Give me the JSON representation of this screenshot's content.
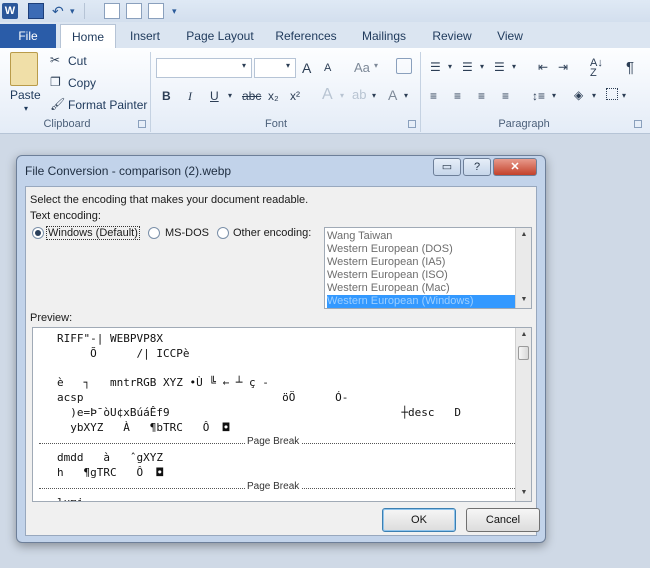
{
  "qat": {
    "logo": "W"
  },
  "tabs": [
    {
      "label": "File"
    },
    {
      "label": "Home"
    },
    {
      "label": "Insert"
    },
    {
      "label": "Page Layout"
    },
    {
      "label": "References"
    },
    {
      "label": "Mailings"
    },
    {
      "label": "Review"
    },
    {
      "label": "View"
    }
  ],
  "ribbon": {
    "clipboard": {
      "paste": "Paste",
      "cut": "Cut",
      "copy": "Copy",
      "format_painter": "Format Painter",
      "label": "Clipboard"
    },
    "font": {
      "label": "Font",
      "bold": "B",
      "italic": "I",
      "underline": "U",
      "strike": "abc",
      "sub": "x₂",
      "sup": "x²",
      "grow": "A",
      "shrink": "A",
      "change_case": "Aa"
    },
    "paragraph": {
      "label": "Paragraph",
      "pilcrow": "¶"
    }
  },
  "dialog": {
    "title": "File Conversion - comparison (2).webp",
    "instruction": "Select the encoding that makes your document readable.",
    "text_encoding_label": "Text encoding:",
    "options": [
      {
        "label": "Windows (Default)",
        "selected": true
      },
      {
        "label": "MS-DOS",
        "selected": false
      },
      {
        "label": "Other encoding:",
        "selected": false
      }
    ],
    "encodings": [
      "Wang Taiwan",
      "Western European (DOS)",
      "Western European (IA5)",
      "Western European (ISO)",
      "Western European (Mac)",
      "Western European (Windows)"
    ],
    "selected_encoding": "Western European (Windows)",
    "preview_label": "Preview:",
    "preview_lines": [
      "RIFF\"-| WEBPVP8X",
      "     Õ      /| ICCPè",
      "",
      "è   ┐   mntrRGB XYZ •Ù ╚ ← ┴ ç -",
      "acsp                              öÖ      Ó-",
      "  )e=Þ¯òU¢xBúáÊf9                                   ┼desc   D",
      "  ybXYZ   À   ¶bTRC   Ô  ◘"
    ],
    "page_break": "Page Break",
    "preview_lines_2": [
      "dmdd   à   ˆgXYZ",
      "h   ¶gTRC   Ô  ◘"
    ],
    "preview_lines_3": [
      "lumi"
    ],
    "ok": "OK",
    "cancel": "Cancel"
  },
  "colors": {
    "file_tab": "#2a5ca8",
    "selection": "#3399ff",
    "dialog_frame": "#c2d3ea"
  }
}
